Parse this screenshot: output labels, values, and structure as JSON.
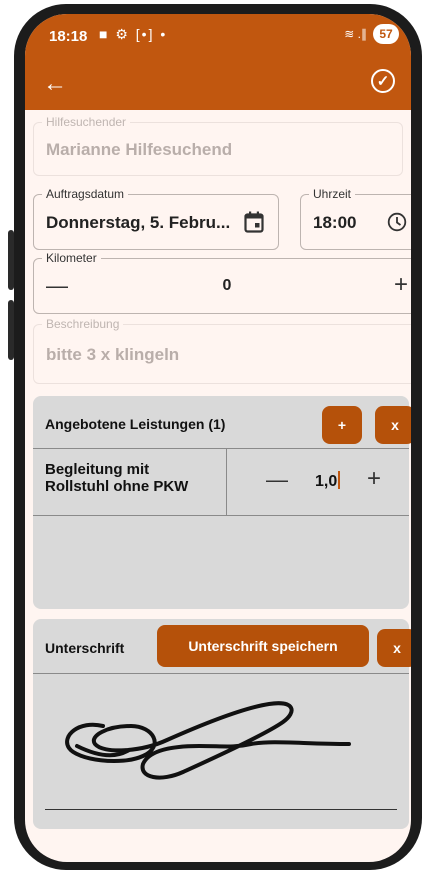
{
  "status_bar": {
    "time": "18:18",
    "left_icons": "■ ⚙ [•] •",
    "signal": "≋ .∥",
    "battery": "57"
  },
  "colors": {
    "accent": "#c1570f",
    "button": "#b5510a",
    "background": "#fff5f1",
    "section": "#d9d9d9"
  },
  "form": {
    "hilfesuchender": {
      "label": "Hilfesuchender",
      "value": "Marianne Hilfesuchend"
    },
    "auftragsdatum": {
      "label": "Auftragsdatum",
      "value": "Donnerstag, 5. Febru..."
    },
    "uhrzeit": {
      "label": "Uhrzeit",
      "value": "18:00"
    },
    "kilometer": {
      "label": "Kilometer",
      "value": "0",
      "minus": "—",
      "plus": "+"
    },
    "beschreibung": {
      "label": "Beschreibung",
      "value": "bitte 3 x klingeln"
    }
  },
  "leistungen": {
    "title": "Angebotene Leistungen (1)",
    "add_label": "+",
    "remove_label": "x",
    "items": [
      {
        "name": "Begleitung mit Rollstuhl ohne PKW",
        "minus": "—",
        "quantity": "1,0",
        "plus": "+"
      }
    ]
  },
  "unterschrift": {
    "title": "Unterschrift",
    "save_label": "Unterschrift speichern",
    "clear_label": "x"
  }
}
